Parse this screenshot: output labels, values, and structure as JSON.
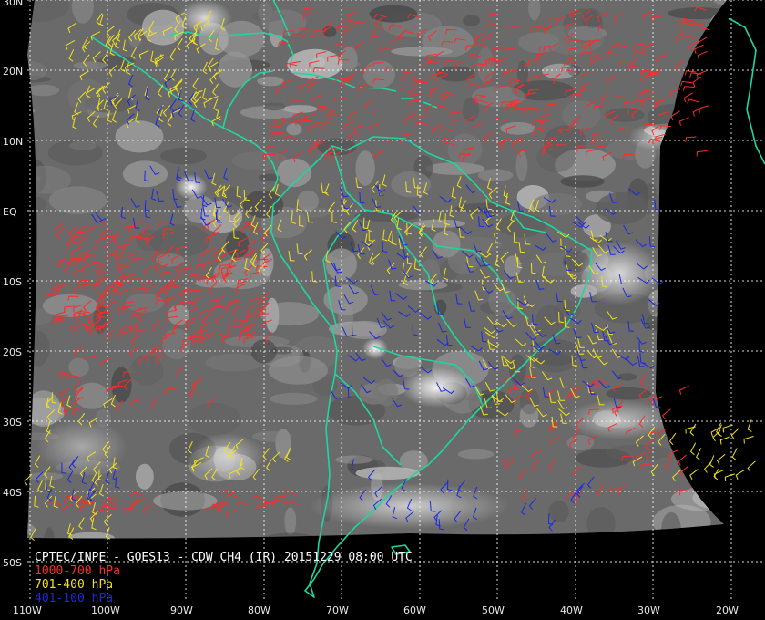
{
  "caption": {
    "title": "CPTEC/INPE - GOES13 - CDW CH4 (IR) 20151229 08:00 UTC"
  },
  "legend": [
    {
      "label": "1000-700 hPa",
      "color": "#ff2a2a"
    },
    {
      "label": "701-400 hPa",
      "color": "#f2e21a"
    },
    {
      "label": "401-100 hPa",
      "color": "#1b28e6"
    }
  ],
  "latitude_labels": [
    "30N",
    "20N",
    "10N",
    "EQ",
    "10S",
    "20S",
    "30S",
    "40S",
    "50S"
  ],
  "longitude_labels": [
    "110W",
    "100W",
    "90W",
    "80W",
    "70W",
    "60W",
    "50W",
    "40W",
    "30W",
    "20W"
  ],
  "colors": {
    "coastline": "#1fd6a0",
    "graticule": "#ffffff",
    "wind_low": "#ff2a2a",
    "wind_mid": "#f2e21a",
    "wind_high": "#1b28e6"
  }
}
